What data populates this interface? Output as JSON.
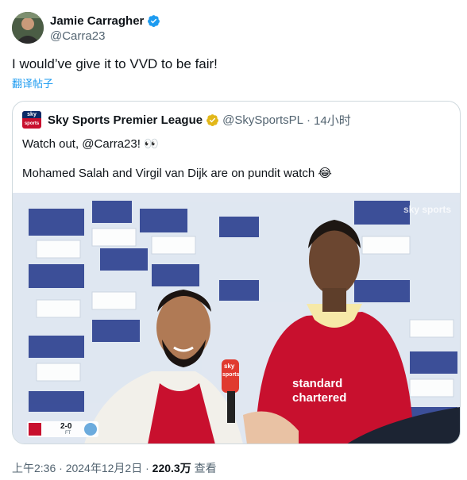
{
  "author": {
    "display_name": "Jamie Carragher",
    "handle": "@Carra23",
    "verified_icon": "blue-verified-badge"
  },
  "tweet": {
    "text": "I would’ve give it to VVD to be fair!",
    "translate_label": "翻译帖子"
  },
  "quoted": {
    "display_name": "Sky Sports Premier League",
    "handle": "@SkySportsPL",
    "separator": "·",
    "time": "14小时",
    "line1": "Watch out, @Carra23! 👀",
    "line2": "Mohamed Salah and Virgil van Dijk are on pundit watch 😂",
    "logo_top": "sky",
    "logo_bottom": "sports",
    "badge_icon": "gold-verified-badge"
  },
  "media": {
    "scoreboard": "2-0",
    "scoreboard_sub": "FT",
    "watermark": "sky sports",
    "mic_flag_top": "sky",
    "mic_flag_bottom": "sports"
  },
  "meta": {
    "time": "上午2:36",
    "sep1": "·",
    "date": "2024年12月2日",
    "sep2": "·",
    "views": "220.3万",
    "views_label": "查看"
  },
  "colors": {
    "link_blue": "#1d9bf0",
    "muted": "#536471",
    "text": "#0f1419",
    "liverpool_red": "#c8102e"
  }
}
